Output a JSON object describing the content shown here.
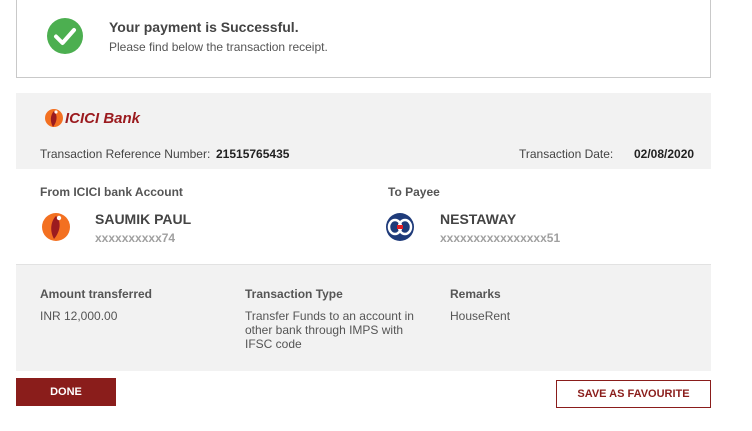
{
  "success": {
    "title": "Your payment is Successful.",
    "subtitle": "Please find below the transaction receipt.",
    "icon": "check-circle-icon",
    "color": "#4caf50"
  },
  "receipt": {
    "bank_logo_text": "ICICI Bank",
    "reference_label": "Transaction Reference Number:",
    "reference_value": "21515765435",
    "date_label": "Transaction Date:",
    "date_value": "02/08/2020"
  },
  "from": {
    "section_label": "From ICICI bank Account",
    "name": "SAUMIK PAUL",
    "account": "xxxxxxxxxx74",
    "icon": "icici-logo-icon"
  },
  "to": {
    "section_label": "To Payee",
    "name": "NESTAWAY",
    "account": "xxxxxxxxxxxxxxxx51",
    "icon": "kotak-logo-icon"
  },
  "details": {
    "amount_label": "Amount transferred",
    "amount_value": "INR 12,000.00",
    "type_label": "Transaction Type",
    "type_value": "Transfer Funds to an account in other bank through IMPS with IFSC code",
    "remarks_label": "Remarks",
    "remarks_value": "HouseRent"
  },
  "actions": {
    "done_label": "DONE",
    "favourite_label": "SAVE AS FAVOURITE"
  },
  "colors": {
    "brand": "#8a1d1b",
    "icici_orange": "#f37021",
    "success_green": "#4caf50"
  }
}
